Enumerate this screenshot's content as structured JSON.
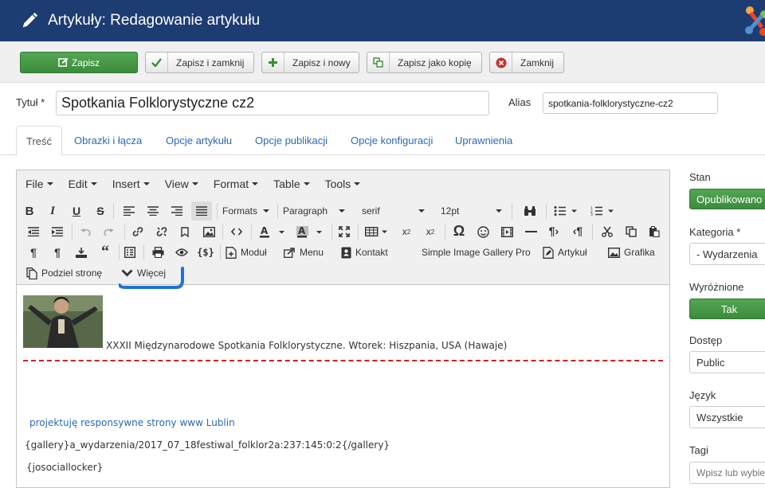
{
  "header": {
    "title": "Artykuły: Redagowanie artykułu"
  },
  "toolbar": {
    "save": "Zapisz",
    "save_close": "Zapisz i zamknij",
    "save_new": "Zapisz i nowy",
    "save_copy": "Zapisz jako kopię",
    "close": "Zamknij"
  },
  "form": {
    "title_label": "Tytuł *",
    "title_value": "Spotkania Folklorystyczne cz2",
    "alias_label": "Alias",
    "alias_value": "spotkania-folklorystyczne-cz2"
  },
  "tabs": [
    "Treść",
    "Obrazki i łącza",
    "Opcje artykułu",
    "Opcje publikacji",
    "Opcje konfiguracji",
    "Uprawnienia"
  ],
  "editor": {
    "menus": [
      "File",
      "Edit",
      "Insert",
      "View",
      "Format",
      "Table",
      "Tools"
    ],
    "formats": "Formats",
    "block": "Paragraph",
    "font": "serif",
    "size": "12pt",
    "buttons": {
      "modul": "Moduł",
      "menu": "Menu",
      "kontakt": "Kontakt",
      "gallery": "Simple Image Gallery Pro",
      "artykul": "Artykuł",
      "grafika": "Grafika",
      "podziel": "Podziel stronę",
      "wiecej": "Więcej"
    },
    "content": {
      "caption": "XXXII Międzynarodowe Spotkania Folklorystyczne. Wtorek: Hiszpania, USA (Hawaje)",
      "link": "projektuję responsywne strony www Lublin",
      "gallery": "{gallery}a_wydarzenia/2017_07_18festiwal_folklor2a:237:145:0:2{/gallery}",
      "locker": "{josociallocker}"
    }
  },
  "sidebar": {
    "stan_label": "Stan",
    "stan_value": "Opublikowano",
    "kategoria_label": "Kategoria *",
    "kategoria_value": "- Wydarzenia",
    "wyroznione_label": "Wyróżnione",
    "wyroznione_value": "Tak",
    "dostep_label": "Dostęp",
    "dostep_value": "Public",
    "jezyk_label": "Język",
    "jezyk_value": "Wszystkie",
    "tagi_label": "Tagi",
    "tagi_placeholder": "Wpisz lub wybierz"
  },
  "colors": {
    "header": "#1d3c72",
    "success": "#46a546",
    "link": "#2a69b8",
    "readmore": "#d42020"
  }
}
